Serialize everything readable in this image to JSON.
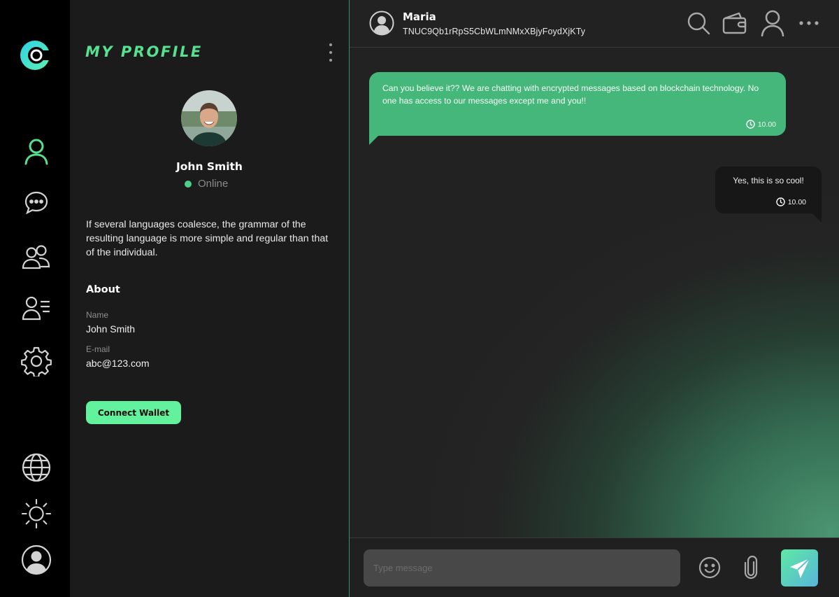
{
  "rail": {
    "logo": "chat-app-logo",
    "nav": [
      {
        "icon": "profile-icon",
        "active": true
      },
      {
        "icon": "chats-icon",
        "active": false
      },
      {
        "icon": "groups-icon",
        "active": false
      },
      {
        "icon": "contacts-icon",
        "active": false
      },
      {
        "icon": "settings-icon",
        "active": false
      }
    ],
    "bottom": [
      "globe-icon",
      "sun-icon",
      "account-icon"
    ]
  },
  "profile": {
    "title": "MY PROFILE",
    "name": "John Smith",
    "status": "Online",
    "bio": "If several languages coalesce, the grammar of the resulting language is more simple and regular than that of the individual.",
    "about_heading": "About",
    "fields": [
      {
        "label": "Name",
        "value": "John Smith"
      },
      {
        "label": "E-mail",
        "value": "abc@123.com"
      }
    ],
    "connect_label": "Connect Wallet"
  },
  "chat": {
    "contact_name": "Maria",
    "contact_address": "TNUC9Qb1rRpS5CbWLmNMxXBjyFoydXjKTy",
    "header_icons": [
      "search-icon",
      "wallet-icon",
      "user-icon",
      "more-icon"
    ],
    "messages": [
      {
        "direction": "incoming",
        "text": "Can you believe it?? We are chatting with encrypted messages based on blockchain technology. No one has access to our messages except me and you!!",
        "time": "10.00"
      },
      {
        "direction": "outgoing",
        "text": "Yes, this is so cool!",
        "time": "10.00"
      }
    ],
    "composer": {
      "placeholder": "Type message",
      "icons": [
        "emoji-icon",
        "attachment-icon",
        "send-icon"
      ]
    }
  },
  "colors": {
    "accent": "#56e08f",
    "bubble_incoming": "#46b77b",
    "bubble_outgoing": "#171717",
    "panel": "#1b1b1b",
    "rail": "#000000"
  }
}
